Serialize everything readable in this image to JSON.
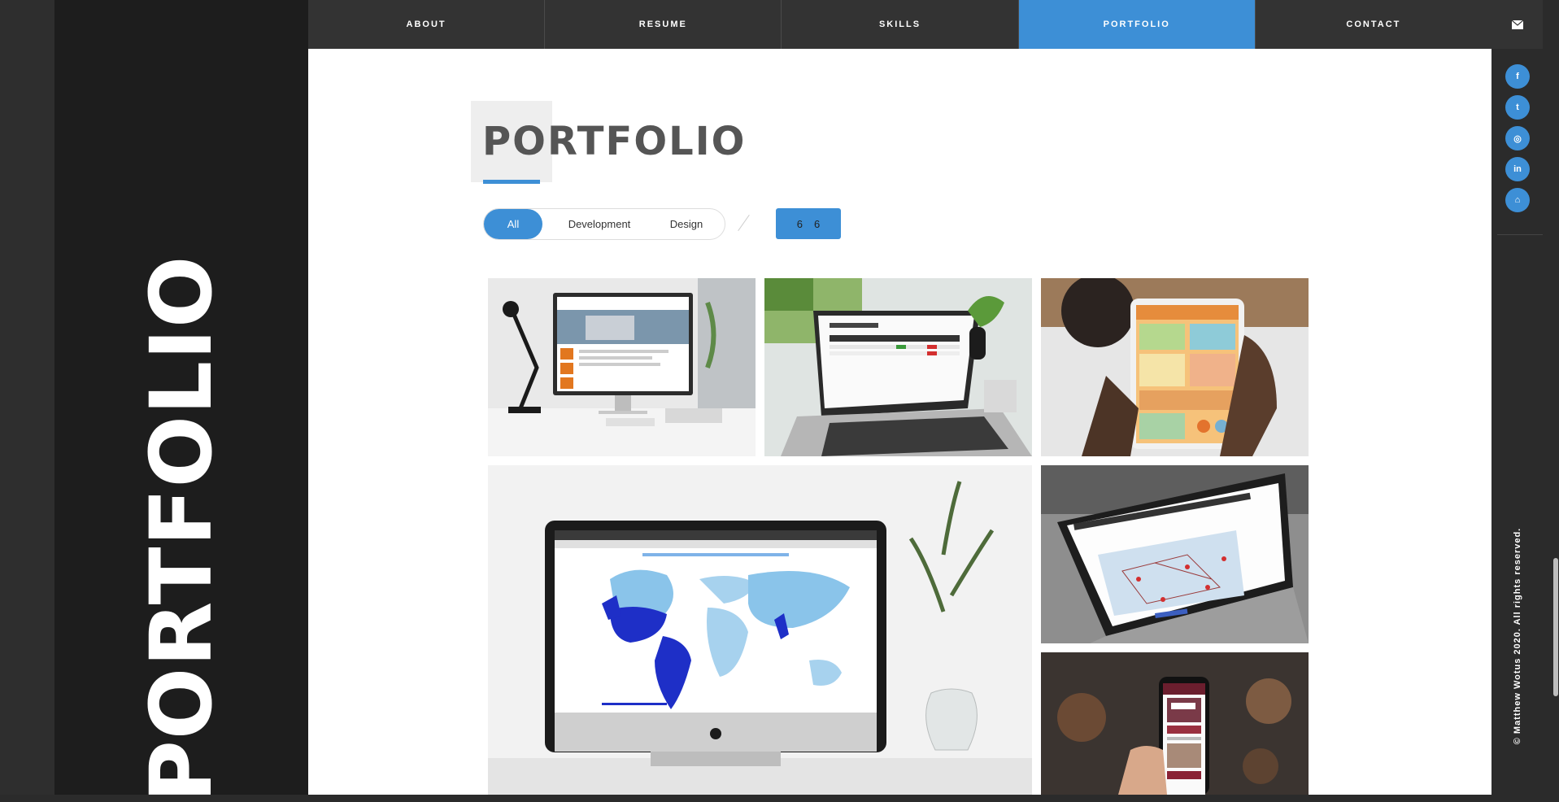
{
  "side_title": "PORTFOLIO",
  "nav": {
    "items": [
      {
        "label": "ABOUT"
      },
      {
        "label": "RESUME"
      },
      {
        "label": "SKILLS"
      },
      {
        "label": "PORTFOLIO",
        "active": true
      },
      {
        "label": "CONTACT"
      }
    ]
  },
  "section": {
    "title": "PORTFOLIO"
  },
  "filters": {
    "items": [
      {
        "label": "All",
        "active": true
      },
      {
        "label": "Development"
      },
      {
        "label": "Design"
      }
    ]
  },
  "counter": {
    "current": "6",
    "total": "6"
  },
  "portfolio": {
    "items": [
      {
        "icon": "capitol-website-on-desktop-image"
      },
      {
        "icon": "student-grade-table-on-laptop-image"
      },
      {
        "icon": "infographic-on-tablet-image"
      },
      {
        "icon": "world-map-dashboard-on-imac-image"
      },
      {
        "icon": "campaign-travel-map-on-laptop-image"
      },
      {
        "icon": "mobile-website-on-phone-image"
      }
    ]
  },
  "social": {
    "items": [
      {
        "glyph": "f",
        "icon": "facebook-icon"
      },
      {
        "glyph": "t",
        "icon": "twitter-icon"
      },
      {
        "glyph": "◎",
        "icon": "instagram-icon"
      },
      {
        "glyph": "in",
        "icon": "linkedin-icon"
      },
      {
        "glyph": "⌂",
        "icon": "github-icon"
      }
    ]
  },
  "footer": {
    "copyright": "© Matthew Wotus 2020. All rights reserved."
  },
  "colors": {
    "accent": "#3d8fd6",
    "nav_bg": "#333333",
    "side_panel": "#1d1d1d"
  }
}
